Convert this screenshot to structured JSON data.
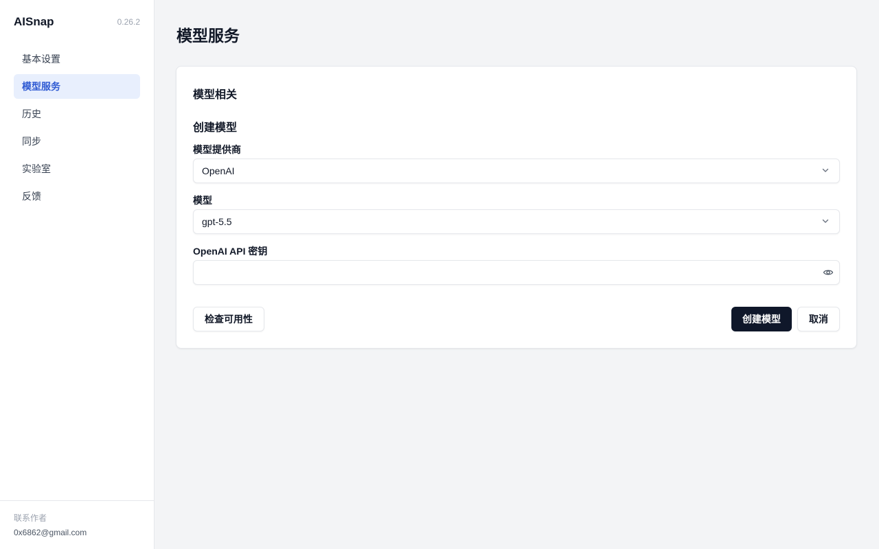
{
  "sidebar": {
    "brand": "AISnap",
    "version": "0.26.2",
    "nav": [
      {
        "label": "基本设置",
        "active": false
      },
      {
        "label": "模型服务",
        "active": true
      },
      {
        "label": "历史",
        "active": false
      },
      {
        "label": "同步",
        "active": false
      },
      {
        "label": "实验室",
        "active": false
      },
      {
        "label": "反馈",
        "active": false
      }
    ],
    "contact_label": "联系作者",
    "contact_email": "0x6862@gmail.com"
  },
  "main": {
    "page_title": "模型服务",
    "section_title": "模型相关",
    "form": {
      "title": "创建模型",
      "provider_label": "模型提供商",
      "provider_value": "OpenAI",
      "model_label": "模型",
      "model_value": "gpt-5.5",
      "api_key_label": "OpenAI API 密钥",
      "api_key_value": "",
      "check_button": "检查可用性",
      "create_button": "创建模型",
      "cancel_button": "取消"
    }
  },
  "icons": {
    "provider_dropdown": "chevron-down-icon",
    "model_dropdown": "chevron-down-icon",
    "api_key_toggle": "eye-icon"
  },
  "colors": {
    "accent": "#2f5bd3",
    "active_bg": "#e8effd",
    "primary_button": "#0f172a",
    "page_bg": "#f3f4f6"
  }
}
